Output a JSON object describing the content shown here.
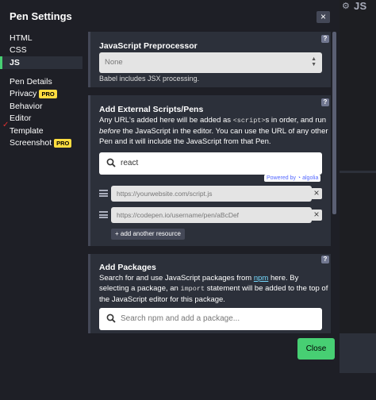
{
  "modal": {
    "title": "Pen Settings",
    "close_icon": "×",
    "close_button": "Close"
  },
  "background": {
    "editor_label": "JS"
  },
  "sidebar": {
    "items": [
      {
        "label": "HTML"
      },
      {
        "label": "CSS"
      },
      {
        "label": "JS",
        "active": true
      },
      {
        "label": "Pen Details"
      },
      {
        "label": "Privacy",
        "badge": "PRO"
      },
      {
        "label": "Behavior"
      },
      {
        "label": "Editor"
      },
      {
        "label": "Template"
      },
      {
        "label": "Screenshot",
        "badge": "PRO"
      }
    ]
  },
  "preprocessor": {
    "title": "JavaScript Preprocessor",
    "help": "?",
    "selected": "None",
    "help_text": "Babel includes JSX processing."
  },
  "external": {
    "title": "Add External Scripts/Pens",
    "help": "?",
    "desc_1": "Any URL's added here will be added as ",
    "desc_code": "<script>",
    "desc_2": "s in order, and run",
    "desc_before": "before",
    "desc_3": " the JavaScript in the editor. You can use the URL of any other Pen and it will include the JavaScript from that Pen.",
    "search_value": "react",
    "powered_by": "Powered by",
    "algolia": "algolia",
    "resources": [
      {
        "placeholder": "https://yourwebsite.com/script.js",
        "remove": "×"
      },
      {
        "placeholder": "https://codepen.io/username/pen/aBcDef",
        "remove": "×"
      }
    ],
    "add_resource": "+ add another resource"
  },
  "packages": {
    "title": "Add Packages",
    "help": "?",
    "desc_1": "Search for and use JavaScript packages from ",
    "npm_link": "npm",
    "desc_2": " here. By selecting a package, an ",
    "desc_code": "import",
    "desc_3": " statement will be added to the top of the JavaScript editor for this package.",
    "search_placeholder": "Search npm and add a package..."
  },
  "colors": {
    "accent": "#47cf73",
    "pro_badge": "#ffdd40",
    "panel": "#2c303a",
    "background": "#1e1f26"
  }
}
